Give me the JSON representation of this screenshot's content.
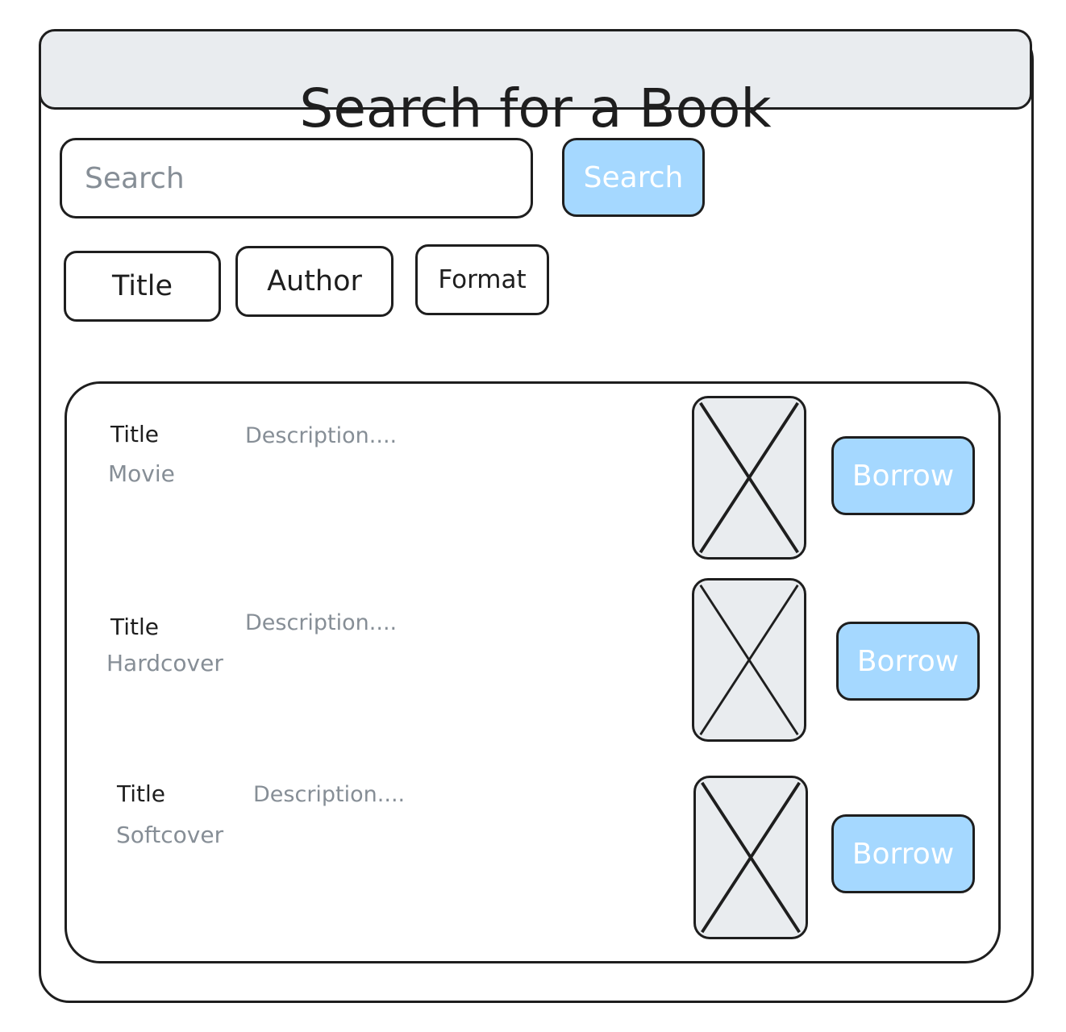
{
  "page": {
    "title": "Search for a Book"
  },
  "search": {
    "placeholder": "Search",
    "value": "",
    "button_label": "Search"
  },
  "filters": [
    {
      "label": "Title"
    },
    {
      "label": "Author"
    },
    {
      "label": "Format"
    }
  ],
  "results": [
    {
      "title": "Title",
      "format": "Movie",
      "description": "Description....",
      "image": "image-placeholder-icon",
      "action_label": "Borrow"
    },
    {
      "title": "Title",
      "format": "Hardcover",
      "description": "Description....",
      "image": "image-placeholder-icon",
      "action_label": "Borrow"
    },
    {
      "title": "Title",
      "format": "Softcover",
      "description": "Description....",
      "image": "image-placeholder-icon",
      "action_label": "Borrow"
    }
  ],
  "colors": {
    "stroke": "#1e1e1e",
    "header_fill": "#e9ecef",
    "button_fill": "#a5d8ff",
    "button_text": "#ffffff",
    "muted_text": "#868e96"
  }
}
